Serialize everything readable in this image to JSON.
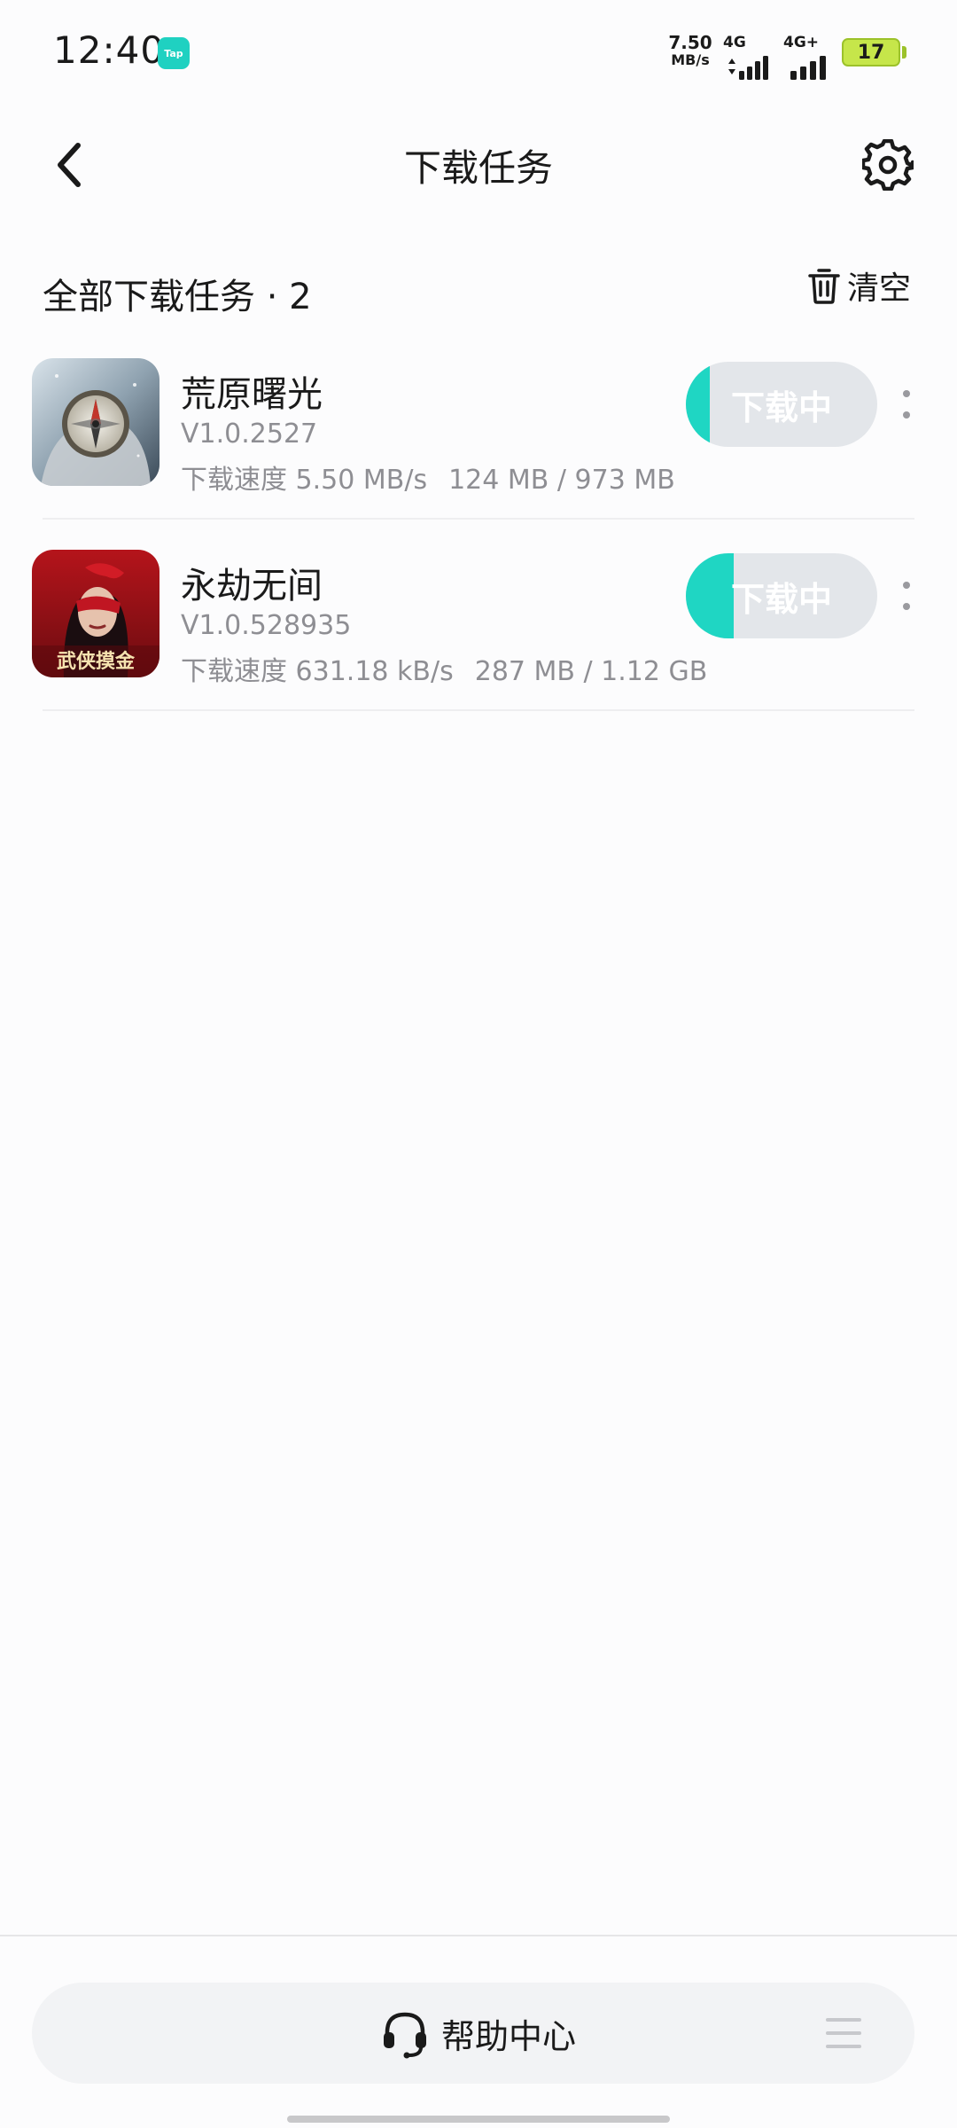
{
  "status_bar": {
    "time": "12:40",
    "app_badge": "Tap",
    "net_speed_value": "7.50",
    "net_speed_unit": "MB/s",
    "signal1_label": "4G",
    "signal2_label": "4G+",
    "battery_level": "17"
  },
  "nav": {
    "title": "下载任务",
    "back_icon": "chevron-left-icon",
    "settings_icon": "gear-icon"
  },
  "section": {
    "title": "全部下载任务 · 2",
    "clear_label": "清空",
    "clear_icon": "trash-icon"
  },
  "downloads": [
    {
      "name": "荒原曙光",
      "version": "V1.0.2527",
      "speed": "下载速度 5.50 MB/s",
      "size": "124 MB / 973 MB",
      "status": "下载中",
      "progress": 0.127,
      "icon": "compass-game-icon"
    },
    {
      "name": "永劫无间",
      "version": "V1.0.528935",
      "speed": "下载速度 631.18 kB/s",
      "size": "287 MB / 1.12 GB",
      "status": "下载中",
      "progress": 0.25,
      "icon": "warrior-game-icon",
      "icon_caption": "武侠摸金"
    }
  ],
  "bottom": {
    "help_label": "帮助中心",
    "help_icon": "headset-icon",
    "menu_icon": "hamburger-menu-icon"
  },
  "colors": {
    "accent": "#1fd6c3",
    "button_bg": "#e3e6ea",
    "secondary_text": "#8e8e93"
  }
}
